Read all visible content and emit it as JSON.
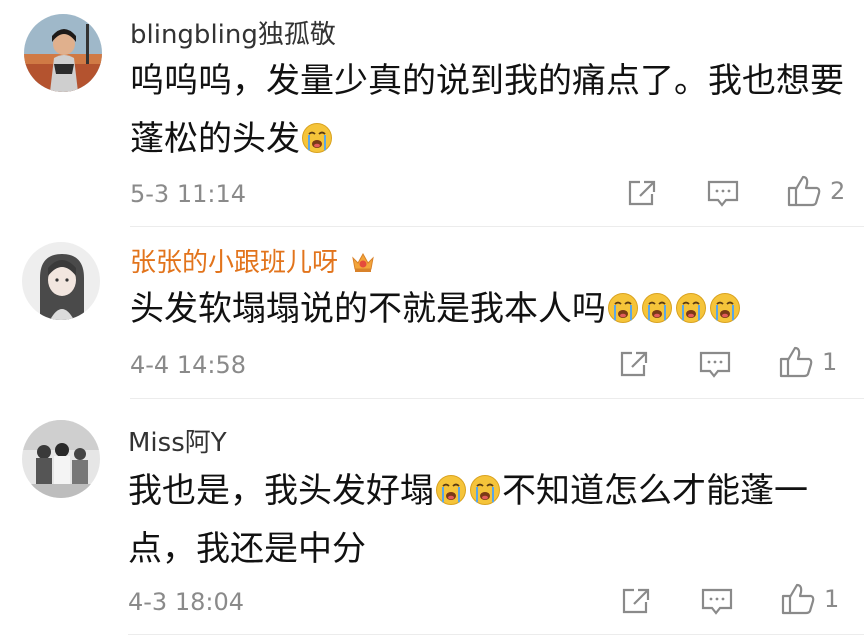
{
  "comments": [
    {
      "username": "blingbling独孤敬",
      "text_lines": [
        "呜呜呜，发量少真的说到我的痛点了。我也想要",
        "蓬松的头发"
      ],
      "emoji_count": 1,
      "timestamp": "5-3 11:14",
      "likes": "2"
    },
    {
      "username": "张张的小跟班儿呀",
      "username_color": "#e2741c",
      "text_lines": [
        "头发软塌塌说的不就是我本人吗"
      ],
      "emoji_count": 4,
      "timestamp": "4-4 14:58",
      "likes": "1"
    },
    {
      "username": "Miss阿Y",
      "text_part1": "我也是，我头发好塌",
      "emoji_count": 2,
      "text_part2": "不知道怎么才能蓬一",
      "text_line2": "点，我还是中分",
      "timestamp": "4-3 18:04",
      "likes": "1"
    }
  ],
  "icons": {
    "share": "share-icon",
    "comment": "comment-icon",
    "like": "like-icon",
    "emoji": "crying-emoji",
    "badge": "vip-crown-badge-icon"
  },
  "colors": {
    "meta": "#8a8a8a",
    "highlight_name": "#e2741c",
    "emoji_face": "#f5c43a",
    "emoji_tear": "#5aa6e6"
  }
}
